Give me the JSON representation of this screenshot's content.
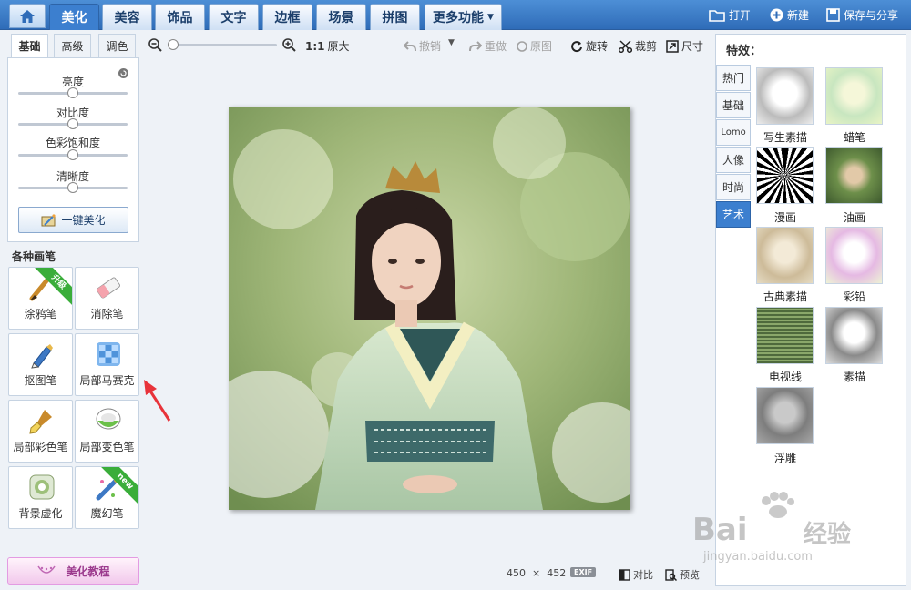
{
  "top_nav": {
    "tabs": [
      "美化",
      "美容",
      "饰品",
      "文字",
      "边框",
      "场景",
      "拼图",
      "更多功能"
    ],
    "active_tab": "美化",
    "actions": {
      "open": "打开",
      "new": "新建",
      "save": "保存与分享"
    }
  },
  "left_panel": {
    "subtabs": [
      "基础",
      "高级",
      "调色"
    ],
    "active_subtab": "基础",
    "sliders": [
      {
        "label": "亮度",
        "value": 0.5
      },
      {
        "label": "对比度",
        "value": 0.5
      },
      {
        "label": "色彩饱和度",
        "value": 0.5
      },
      {
        "label": "清晰度",
        "value": 0.5
      }
    ],
    "one_key_label": "一键美化",
    "brushes_title": "各种画笔",
    "brushes": [
      {
        "label": "涂鸦笔",
        "badge": "升级"
      },
      {
        "label": "消除笔",
        "badge": ""
      },
      {
        "label": "抠图笔",
        "badge": ""
      },
      {
        "label": "局部马赛克",
        "badge": ""
      },
      {
        "label": "局部彩色笔",
        "badge": ""
      },
      {
        "label": "局部变色笔",
        "badge": ""
      },
      {
        "label": "背景虚化",
        "badge": ""
      },
      {
        "label": "魔幻笔",
        "badge": "new"
      }
    ],
    "tutorial_label": "美化教程"
  },
  "toolbar": {
    "zoom_level": 0,
    "actual_size_label": "1:1",
    "original_size_label": "原大",
    "undo_label": "撤销",
    "redo_label": "重做",
    "original_label": "原图",
    "rotate_label": "旋转",
    "crop_label": "裁剪",
    "size_label": "尺寸"
  },
  "status": {
    "width": "450",
    "times": "×",
    "height": "452",
    "exif": "EXIF",
    "compare_label": "对比",
    "preview_label": "预览"
  },
  "effects": {
    "title": "特效：",
    "tabs": [
      "热门",
      "基础",
      "Lomo",
      "人像",
      "时尚",
      "艺术"
    ],
    "active_tab": "艺术",
    "items": [
      "写生素描",
      "蜡笔",
      "漫画",
      "油画",
      "古典素描",
      "彩铅",
      "电视线",
      "素描",
      "浮雕"
    ]
  },
  "watermark": {
    "brand": "Bai",
    "brand_cn": "经验",
    "url": "jingyan.baidu.com"
  },
  "colors": {
    "accent": "#3c7fcf",
    "topbar": "#2f6cb8",
    "arrow": "#e8333a"
  }
}
